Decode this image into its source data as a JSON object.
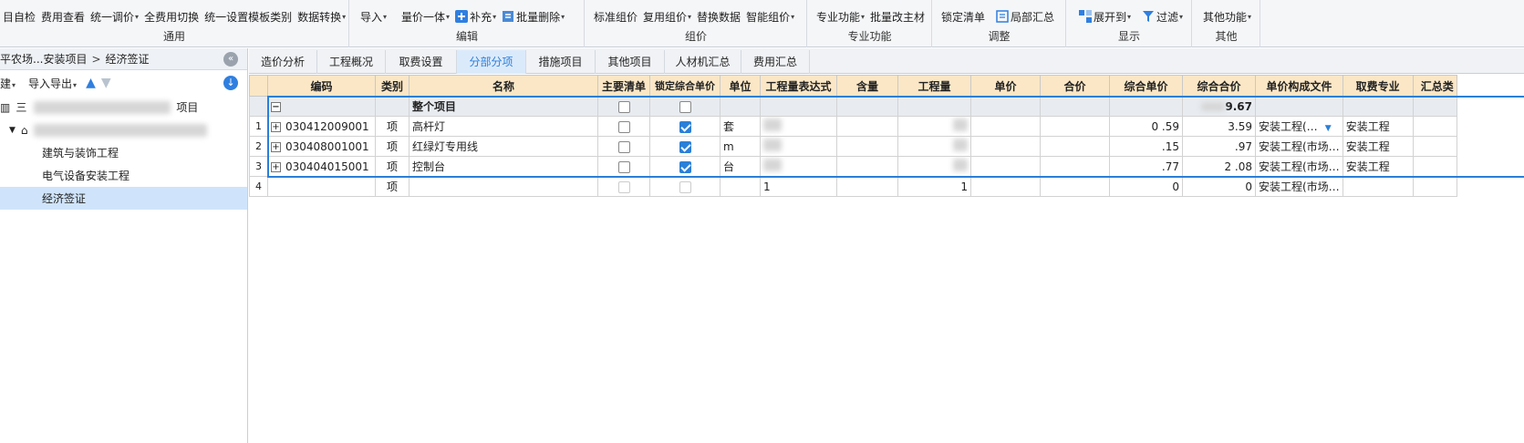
{
  "ribbon": {
    "groups": [
      {
        "title": "通用",
        "items": [
          {
            "label": "目自检",
            "icon": "check-icon",
            "caret": false
          },
          {
            "label": "费用查看",
            "icon": "view-icon",
            "caret": false
          },
          {
            "label": "统一调价",
            "icon": "price-icon",
            "caret": true
          },
          {
            "label": "全费用切换",
            "icon": "switch-icon",
            "caret": false
          },
          {
            "label": "统一设置模板类别",
            "icon": "template-icon",
            "caret": false
          },
          {
            "label": "数据转换",
            "icon": "convert-icon",
            "caret": true
          }
        ]
      },
      {
        "title": "编辑",
        "items": [
          {
            "label": "导入",
            "icon": "import-icon",
            "caret": true
          },
          {
            "label": "量价一体",
            "icon": "integrate-icon",
            "caret": true
          },
          {
            "label": "补充",
            "icon": "plus-icon",
            "caret": true
          },
          {
            "label": "批量删除",
            "icon": "delete-icon",
            "caret": true
          }
        ]
      },
      {
        "title": "组价",
        "items": [
          {
            "label": "标准组价",
            "icon": "standard-icon",
            "caret": false
          },
          {
            "label": "复用组价",
            "icon": "reuse-icon",
            "caret": true
          },
          {
            "label": "替换数据",
            "icon": "replace-icon",
            "caret": false
          },
          {
            "label": "智能组价",
            "icon": "smart-icon",
            "caret": true
          }
        ]
      },
      {
        "title": "专业功能",
        "items": [
          {
            "label": "专业功能",
            "icon": "pro-icon",
            "caret": true
          },
          {
            "label": "批量改主材",
            "icon": "material-icon",
            "caret": false
          }
        ]
      },
      {
        "title": "调整",
        "items": [
          {
            "label": "锁定清单",
            "icon": "lock-icon",
            "caret": false
          },
          {
            "label": "局部汇总",
            "icon": "summary-icon",
            "caret": false
          }
        ]
      },
      {
        "title": "显示",
        "items": [
          {
            "label": "展开到",
            "icon": "expand-icon",
            "caret": true
          },
          {
            "label": "过滤",
            "icon": "filter-icon",
            "caret": true
          }
        ]
      },
      {
        "title": "其他",
        "items": [
          {
            "label": "其他功能",
            "icon": "other-icon",
            "caret": true
          }
        ]
      }
    ]
  },
  "left": {
    "breadcrumb": [
      "平农场...安装项目",
      "经济签证"
    ],
    "tools": {
      "new_label": "建",
      "import_export_label": "导入导出"
    },
    "tree": [
      {
        "label": "项目",
        "level": 0
      },
      {
        "label": "",
        "level": 1
      },
      {
        "label": "建筑与装饰工程",
        "level": 2
      },
      {
        "label": "电气设备安装工程",
        "level": 2
      },
      {
        "label": "经济签证",
        "level": 2,
        "selected": true
      }
    ],
    "tree_root_prefix": "三"
  },
  "tabs": [
    "造价分析",
    "工程概况",
    "取费设置",
    "分部分项",
    "措施项目",
    "其他项目",
    "人材机汇总",
    "费用汇总"
  ],
  "active_tab": "分部分项",
  "grid": {
    "headers": [
      "编码",
      "类别",
      "名称",
      "主要清单",
      "锁定综合单价",
      "单位",
      "工程量表达式",
      "含量",
      "工程量",
      "单价",
      "合价",
      "综合单价",
      "综合合价",
      "单价构成文件",
      "取费专业",
      "汇总类"
    ],
    "summary": {
      "name": "整个项目",
      "total_visible": "9.67"
    },
    "rows": [
      {
        "num": "1",
        "code": "030412009001",
        "type": "项",
        "name": "高杆灯",
        "main": false,
        "locked": true,
        "unit": "套",
        "expr": "",
        "qty": "",
        "unit_total": "0 .59",
        "total": "3.59",
        "doc": "安装工程(…",
        "prof": "安装工程"
      },
      {
        "num": "2",
        "code": "030408001001",
        "type": "项",
        "name": "红绿灯专用线",
        "main": false,
        "locked": true,
        "unit": "m",
        "expr": "",
        "qty": "",
        "unit_total": ".15",
        "total": ".97",
        "doc": "安装工程(市场…",
        "prof": "安装工程"
      },
      {
        "num": "3",
        "code": "030404015001",
        "type": "项",
        "name": "控制台",
        "main": false,
        "locked": true,
        "unit": "台",
        "expr": "",
        "qty": "",
        "unit_total": ".77",
        "total": "2 .08",
        "doc": "安装工程(市场…",
        "prof": "安装工程"
      },
      {
        "num": "4",
        "code": "",
        "type": "项",
        "name": "",
        "main": false,
        "locked": false,
        "unit": "",
        "expr": "1",
        "qty": "1",
        "unit_total": "0",
        "total": "0",
        "doc": "安装工程(市场…",
        "prof": ""
      }
    ]
  },
  "colors": {
    "accent": "#2a7fd8",
    "header_bg": "#fbe7c6",
    "selected_tree": "#cfe4fb"
  }
}
